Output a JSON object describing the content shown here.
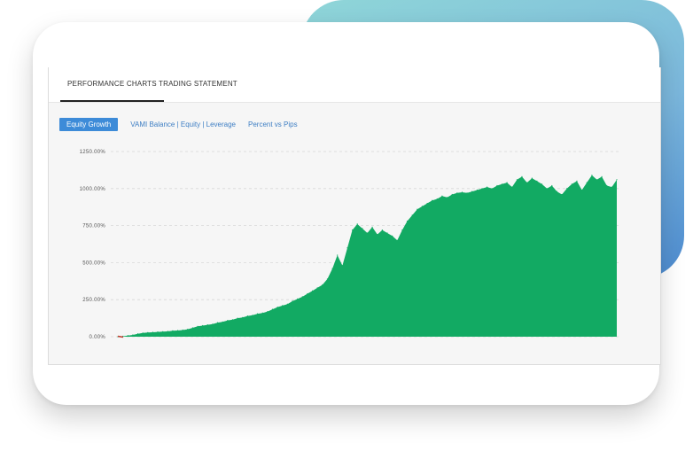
{
  "tabs": [
    {
      "label": "PERFORMANCE CHARTS",
      "active": true
    },
    {
      "label": "TRADING STATEMENT",
      "active": false
    }
  ],
  "chart_buttons": [
    {
      "label": "Equity Growth",
      "active": true
    },
    {
      "label": "VAMI Balance | Equity | Leverage",
      "active": false
    },
    {
      "label": "Percent vs Pips",
      "active": false
    }
  ],
  "colors": {
    "fill": "#12aa63",
    "active_button": "#3d8bd8",
    "link": "#3f7fc4",
    "start_marker": "#c0392b"
  },
  "chart_data": {
    "type": "area",
    "title": "",
    "xlabel": "",
    "ylabel": "",
    "y_tick_labels": [
      "0.00%",
      "250.00%",
      "500.00%",
      "750.00%",
      "1000.00%",
      "1250.00%"
    ],
    "y_ticks": [
      0,
      250,
      500,
      750,
      1000,
      1250
    ],
    "ylim": [
      0,
      1250
    ],
    "grid": true,
    "x": [
      0,
      1,
      2,
      3,
      4,
      5,
      6,
      7,
      8,
      9,
      10,
      11,
      12,
      13,
      14,
      15,
      16,
      17,
      18,
      19,
      20,
      21,
      22,
      23,
      24,
      25,
      26,
      27,
      28,
      29,
      30,
      31,
      32,
      33,
      34,
      35,
      36,
      37,
      38,
      39,
      40,
      41,
      42,
      43,
      44,
      45,
      46,
      47,
      48,
      49,
      50,
      51,
      52,
      53,
      54,
      55,
      56,
      57,
      58,
      59,
      60,
      61,
      62,
      63,
      64,
      65,
      66,
      67,
      68,
      69,
      70,
      71,
      72,
      73,
      74,
      75,
      76,
      77,
      78,
      79,
      80,
      81,
      82,
      83,
      84,
      85,
      86,
      87,
      88,
      89,
      90,
      91,
      92,
      93,
      94,
      95,
      96,
      97,
      98,
      99,
      100
    ],
    "values": [
      0,
      3,
      8,
      12,
      20,
      25,
      28,
      30,
      32,
      34,
      36,
      40,
      42,
      45,
      50,
      60,
      70,
      75,
      80,
      85,
      95,
      100,
      110,
      115,
      125,
      130,
      140,
      145,
      155,
      160,
      170,
      185,
      200,
      210,
      220,
      240,
      255,
      270,
      290,
      310,
      330,
      350,
      390,
      460,
      550,
      480,
      600,
      720,
      760,
      730,
      700,
      740,
      690,
      720,
      700,
      680,
      650,
      720,
      780,
      820,
      860,
      880,
      900,
      920,
      930,
      950,
      940,
      960,
      970,
      975,
      970,
      980,
      990,
      1000,
      1010,
      1000,
      1020,
      1030,
      1040,
      1010,
      1060,
      1080,
      1040,
      1070,
      1050,
      1030,
      1000,
      1020,
      980,
      960,
      1000,
      1030,
      1050,
      990,
      1040,
      1090,
      1060,
      1080,
      1020,
      1010,
      1060
    ],
    "series": [
      {
        "name": "",
        "values": []
      }
    ]
  }
}
